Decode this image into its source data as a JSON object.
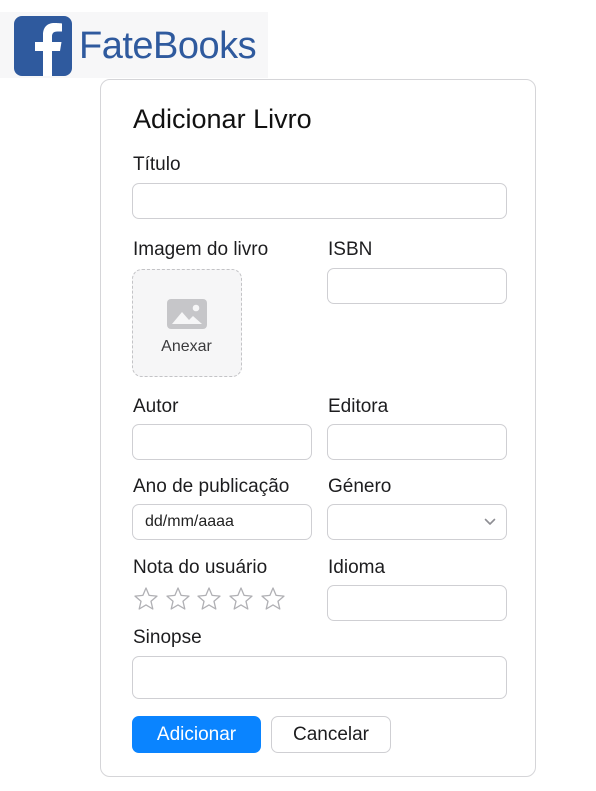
{
  "brand": {
    "name": "FateBooks",
    "mark_letter": "f",
    "color": "#2f5a9e",
    "icon": "facebook-f-logo-icon"
  },
  "form": {
    "title": "Adicionar Livro",
    "fields": {
      "titulo": {
        "label": "Título",
        "value": ""
      },
      "imagem": {
        "label": "Imagem do livro",
        "upload_label": "Anexar",
        "icon": "image-placeholder-icon"
      },
      "isbn": {
        "label": "ISBN",
        "value": ""
      },
      "autor": {
        "label": "Autor",
        "value": ""
      },
      "editora": {
        "label": "Editora",
        "value": ""
      },
      "ano": {
        "label": "Ano de publicação",
        "placeholder": "dd/mm/aaaa"
      },
      "genero": {
        "label": "Género",
        "selected": ""
      },
      "nota": {
        "label": "Nota do usuário",
        "rating": 0,
        "max": 5,
        "icon": "star-outline-icon"
      },
      "idioma": {
        "label": "Idioma",
        "value": ""
      },
      "sinopse": {
        "label": "Sinopse",
        "value": ""
      }
    },
    "buttons": {
      "submit": "Adicionar",
      "cancel": "Cancelar"
    },
    "colors": {
      "primary": "#0a84ff",
      "border": "#cfcfd3",
      "star_outline": "#b0b0b4"
    }
  }
}
